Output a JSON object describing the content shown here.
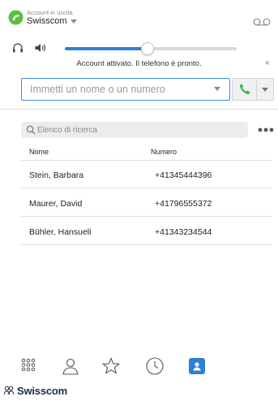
{
  "account": {
    "caption": "Account in uscita",
    "name": "Swisscom"
  },
  "audio": {
    "volume_fraction": 0.48
  },
  "status": {
    "message": "Account attivato. Il telefono è pronto.",
    "close_glyph": "×"
  },
  "dial": {
    "placeholder": "Immetti un nome o un numero",
    "value": ""
  },
  "contacts": {
    "search_placeholder": "Elenco di ricerca",
    "columns": {
      "name": "Nome",
      "number": "Numero"
    },
    "rows": [
      {
        "name": "Stein, Barbara",
        "number": "+41345444396"
      },
      {
        "name": "Maurer, David",
        "number": "+41796555372"
      },
      {
        "name": "Bühler, Hansueli",
        "number": "+41343234544"
      }
    ]
  },
  "nav": {
    "items": [
      "dialpad-icon",
      "contact-icon",
      "favorites-icon",
      "history-icon",
      "contacts-book-icon"
    ],
    "active": "contacts-book-icon"
  },
  "brand": {
    "name": "Swisscom"
  },
  "colors": {
    "accent": "#2e7fd6",
    "call_green": "#33b24a",
    "logo_green": "#5cbf3a"
  }
}
